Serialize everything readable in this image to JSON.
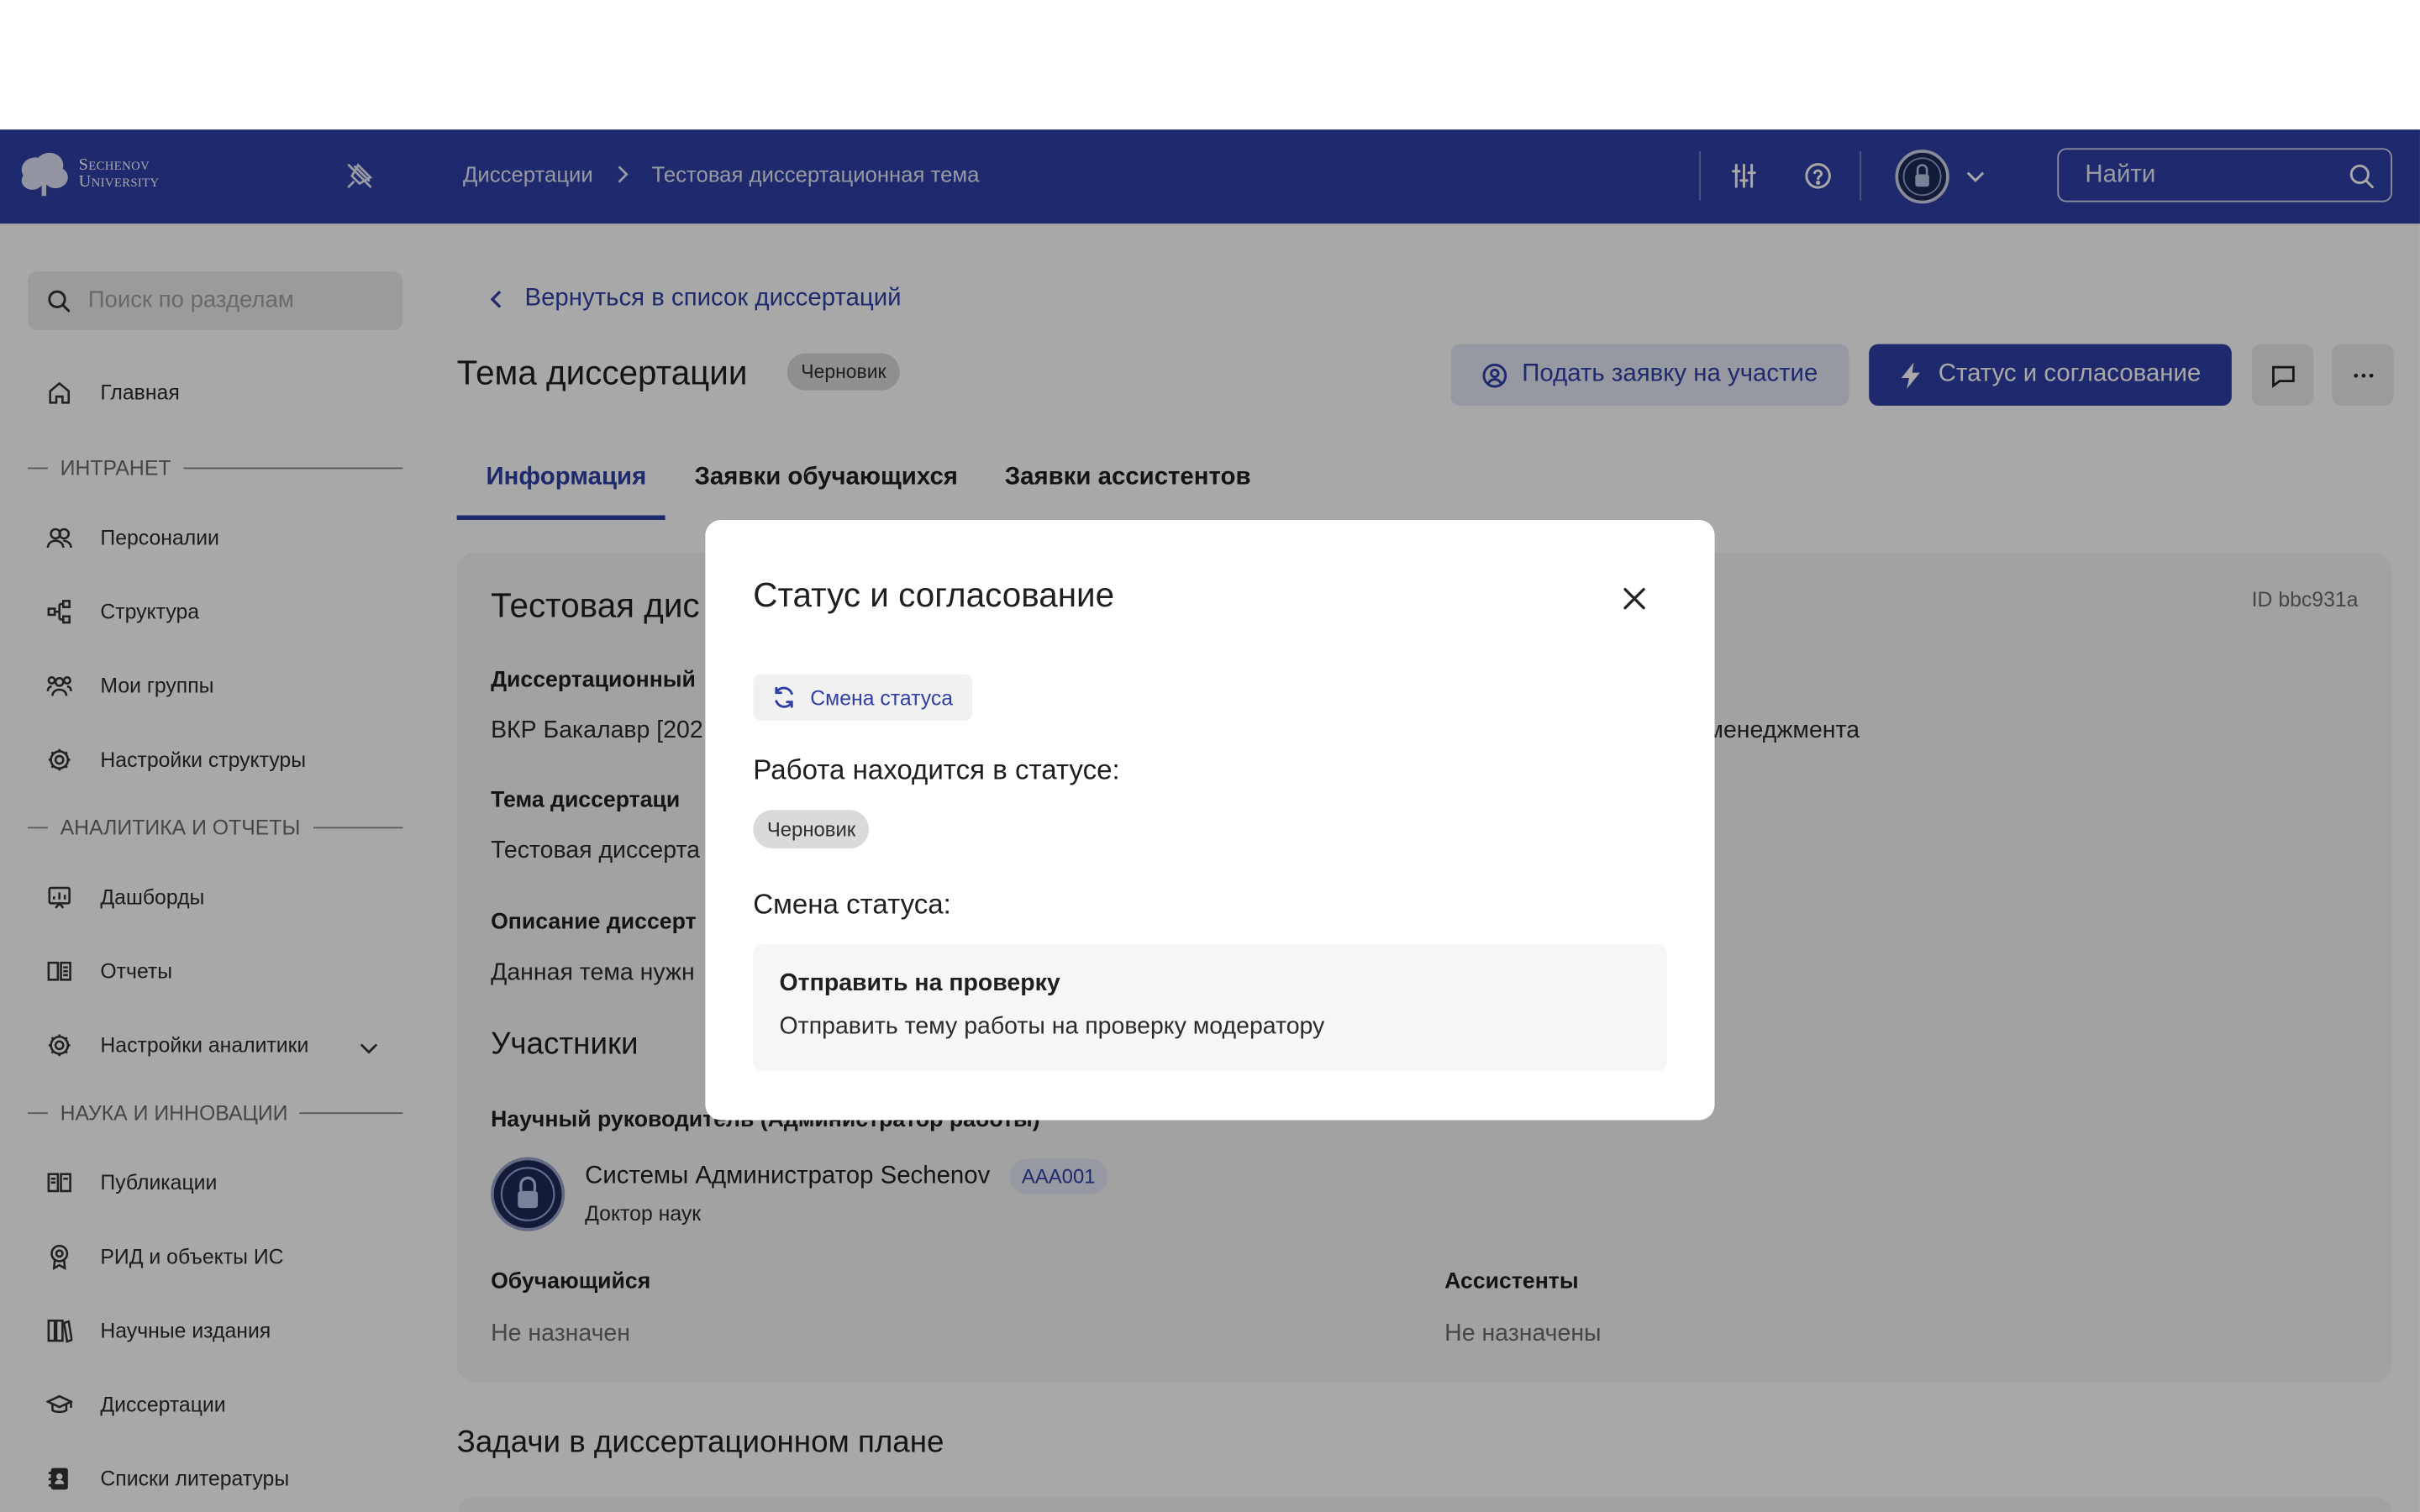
{
  "app": {
    "logo_line1": "Sechenov",
    "logo_line2": "University",
    "search_placeholder": "Найти"
  },
  "breadcrumbs": [
    "Диссертации",
    "Тестовая диссертационная тема"
  ],
  "sidebar": {
    "search_placeholder": "Поиск по разделам",
    "items": [
      {
        "label": "Главная",
        "icon": "home-icon"
      },
      {
        "section": "ИНТРАНЕТ"
      },
      {
        "label": "Персоналии",
        "icon": "users-icon"
      },
      {
        "label": "Структура",
        "icon": "structure-icon"
      },
      {
        "label": "Мои группы",
        "icon": "group-icon"
      },
      {
        "label": "Настройки структуры",
        "icon": "gear-icon"
      },
      {
        "section": "АНАЛИТИКА И ОТЧЕТЫ"
      },
      {
        "label": "Дашборды",
        "icon": "dashboard-icon"
      },
      {
        "label": "Отчеты",
        "icon": "report-icon"
      },
      {
        "label": "Настройки аналитики",
        "icon": "gear-icon"
      },
      {
        "section": "НАУКА И ИННОВАЦИИ"
      },
      {
        "label": "Публикации",
        "icon": "book-icon"
      },
      {
        "label": "РИД и объекты ИС",
        "icon": "award-icon"
      },
      {
        "label": "Научные издания",
        "icon": "books-icon"
      },
      {
        "label": "Диссертации",
        "icon": "graduation-cap-icon"
      },
      {
        "label": "Списки литературы",
        "icon": "notebook-icon"
      }
    ]
  },
  "page": {
    "back_link": "Вернуться в список диссертаций",
    "title": "Тема диссертации",
    "status_badge": "Черновик",
    "apply_button": "Подать заявку на участие",
    "status_button": "Статус и согласование",
    "tabs": [
      "Информация",
      "Заявки обучающихся",
      "Заявки ассистентов"
    ],
    "active_tab": 0
  },
  "card": {
    "title": "Тестовая дис",
    "id": "ID bbc931a",
    "field1_label": "Диссертационный",
    "field1_value": "ВКР Бакалавр [202",
    "field1_value_right": "менеджмента",
    "field2_label": "Тема диссертаци",
    "field2_value": "Тестовая диссерта",
    "field3_label": "Описание диссерт",
    "field3_value": "Данная тема нужн",
    "participants_heading": "Участники",
    "supervisor_label": "Научный руководитель (Администратор работы)",
    "supervisor_name": "Системы Администратор Sechenov",
    "supervisor_code": "AAA001",
    "supervisor_role": "Доктор наук",
    "student_label": "Обучающийся",
    "student_value": "Не назначен",
    "assistants_label": "Ассистенты",
    "assistants_value": "Не назначены"
  },
  "tasks_heading": "Задачи в диссертационном плане",
  "modal": {
    "title": "Статус и согласование",
    "change_status_button": "Смена статуса",
    "current_status_label": "Работа находится в статусе:",
    "current_status": "Черновик",
    "change_label": "Смена статуса:",
    "option_title": "Отправить на проверку",
    "option_desc": "Отправить тему работы на проверку модератору"
  },
  "colors": {
    "brand": "#2f3fa6",
    "brand_light": "#e6e8f6",
    "badge_gray": "#dadada"
  }
}
